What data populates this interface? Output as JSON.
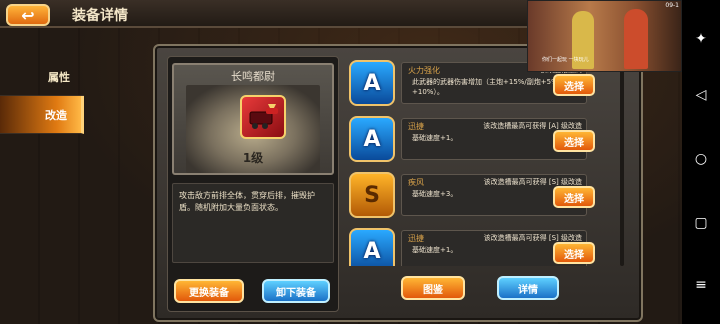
{
  "header": {
    "title": "装备详情",
    "back_icon": "back-arrow-icon"
  },
  "sidenav": {
    "items": [
      {
        "label": "属性",
        "active": false
      },
      {
        "label": "改造",
        "active": true
      }
    ]
  },
  "equipment": {
    "name": "长鸣都尉",
    "level": "1级",
    "description": "攻击敌方前排全体，贯穿后排，摧毁护盾。随机附加大量负面状态。"
  },
  "actions": {
    "replace_label": "更换装备",
    "unequip_label": "卸下装备",
    "catalog_label": "图鉴",
    "detail_label": "详情"
  },
  "mods": [
    {
      "grade": "A",
      "name": "火力强化",
      "note": "该改造槽最高",
      "detail": "此武器的武器伤害增加（主炮+15%/副炮+5%/导弹+10%）。",
      "button": "选择"
    },
    {
      "grade": "A",
      "name": "迅捷",
      "note": "该改造槽最高可获得 [A] 级改造",
      "detail": "基础速度+1。",
      "button": "选择"
    },
    {
      "grade": "S",
      "name": "疾风",
      "note": "该改造槽最高可获得 [S] 级改造",
      "detail": "基础速度+3。",
      "button": "选择"
    },
    {
      "grade": "A",
      "name": "迅捷",
      "note": "该改造槽最高可获得 [S] 级改造",
      "detail": "基础速度+1。",
      "button": "选择"
    }
  ],
  "video_overlay": {
    "time": "09-1",
    "subtitle": "你们一起玩 一块玩儿"
  },
  "colors": {
    "accent": "#e2590b",
    "blue": "#1a71c7",
    "grade_a": "#2aa9ff",
    "grade_s": "#ffb428"
  }
}
